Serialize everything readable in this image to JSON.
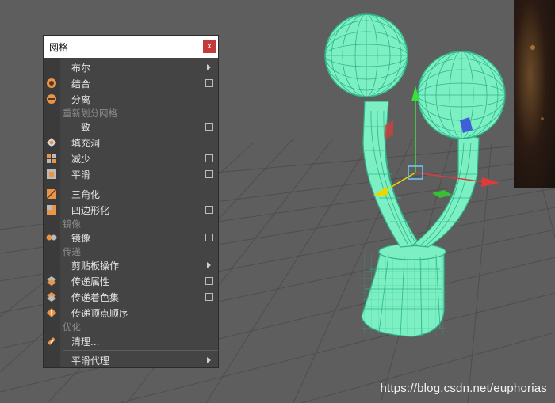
{
  "menu": {
    "title": "网格",
    "close_label": "x",
    "items": [
      {
        "label": "布尔",
        "submenu": true
      },
      {
        "label": "结合",
        "option_box": true
      },
      {
        "label": "分离"
      }
    ],
    "sections": [
      {
        "header": "重新划分网格",
        "items": [
          {
            "label": "一致",
            "option_box": true
          },
          {
            "label": "填充洞"
          },
          {
            "label": "减少",
            "option_box": true
          },
          {
            "label": "平滑",
            "option_box": true
          },
          {
            "label": "三角化"
          },
          {
            "label": "四边形化",
            "option_box": true
          }
        ]
      },
      {
        "header": "镜像",
        "items": [
          {
            "label": "镜像",
            "option_box": true
          }
        ]
      },
      {
        "header": "传递",
        "items": [
          {
            "label": "剪贴板操作",
            "submenu": true
          },
          {
            "label": "传递属性",
            "option_box": true
          },
          {
            "label": "传递着色集",
            "option_box": true
          },
          {
            "label": "传递顶点顺序"
          }
        ]
      },
      {
        "header": "优化",
        "items": [
          {
            "label": "清理..."
          },
          {
            "label": "平滑代理",
            "submenu": true
          }
        ]
      }
    ]
  },
  "watermark": "https://blog.csdn.net/euphorias",
  "colors": {
    "viewport_bg": "#5e5e5e",
    "mesh": "#7df0c3",
    "wire": "#2fb48a",
    "menu_bg": "#444444",
    "icon_orange": "#e8954a"
  },
  "icons": [
    "combine-icon",
    "separate-icon",
    "fill-hole-icon",
    "reduce-icon",
    "smooth-icon",
    "triangulate-icon",
    "quadrangulate-icon",
    "mirror-icon",
    "transfer-attributes-icon",
    "transfer-shading-sets-icon",
    "transfer-vertex-order-icon",
    "cleanup-icon"
  ]
}
